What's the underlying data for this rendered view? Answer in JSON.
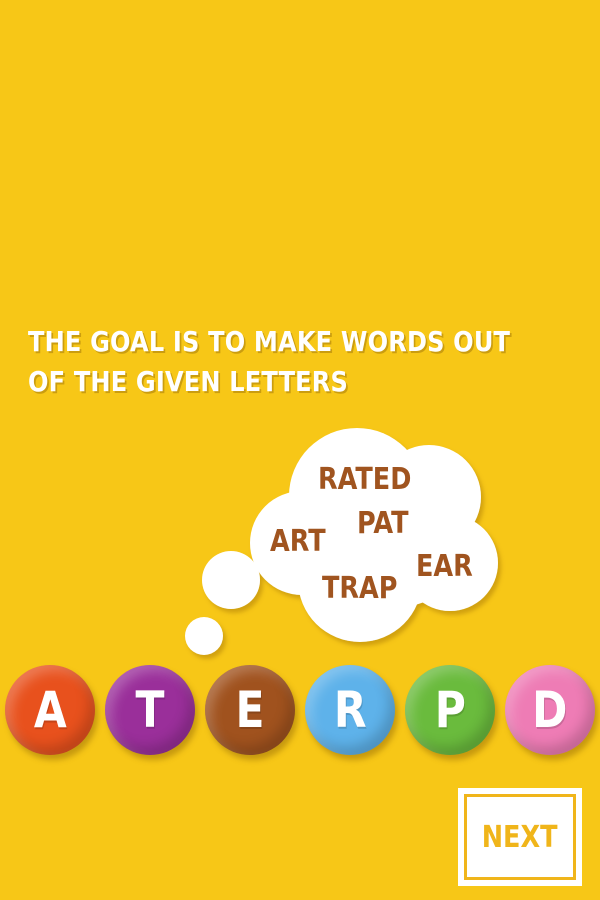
{
  "instruction": {
    "line1": "THE GOAL IS TO MAKE WORDS OUT",
    "line2": "OF THE GIVEN LETTERS"
  },
  "thought_cloud": {
    "words": [
      "RATED",
      "PAT",
      "ART",
      "EAR",
      "TRAP"
    ]
  },
  "letters": [
    {
      "letter": "A",
      "color": "#e8511d"
    },
    {
      "letter": "T",
      "color": "#9a2f9a"
    },
    {
      "letter": "E",
      "color": "#a0521e"
    },
    {
      "letter": "R",
      "color": "#5eb2ea"
    },
    {
      "letter": "P",
      "color": "#6abb3d"
    },
    {
      "letter": "D",
      "color": "#ee7cb5"
    }
  ],
  "next_button": {
    "label": "NEXT"
  },
  "colors": {
    "background": "#f7c717",
    "word_color": "#a0541f",
    "next_accent": "#f0b51a"
  }
}
